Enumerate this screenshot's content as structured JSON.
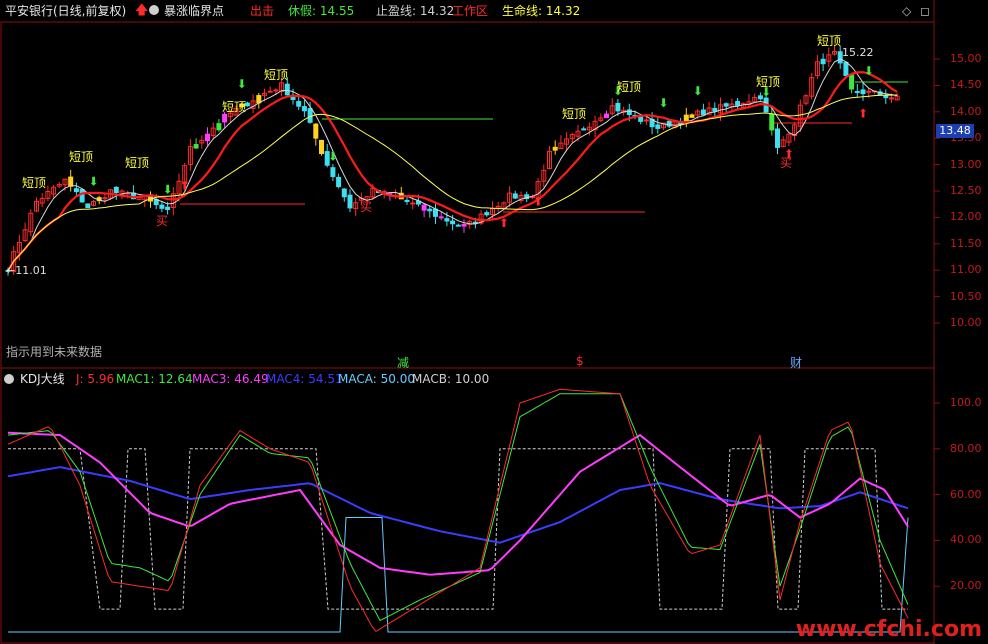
{
  "header": {
    "title": "平安银行(日线,前复权)",
    "indicator_name": "暴涨临界点",
    "items": [
      {
        "label": "出击",
        "value": "",
        "color": "#ff2a2a"
      },
      {
        "label": "休假:",
        "value": "14.55",
        "color": "#3ee83e"
      },
      {
        "label": "止盈线:",
        "value": "14.32",
        "color": "#cfcfcf"
      },
      {
        "label": "工作区",
        "value": "",
        "color": "#ff2a2a"
      },
      {
        "label": "生命线:",
        "value": "14.32",
        "color": "#ffff3c"
      }
    ]
  },
  "main_panel": {
    "price_axis": [
      "15.00",
      "14.50",
      "14.00",
      "13.50",
      "13.00",
      "12.50",
      "12.00",
      "11.50",
      "11.00",
      "10.50",
      "10.00"
    ],
    "current_price": "13.48",
    "high_label": "15.22",
    "low_label": "11.01",
    "signal_short_top": "短顶",
    "signal_buy": "买",
    "note": "指示用到未来数据",
    "bottom_markers": [
      {
        "text": "减",
        "color": "#3ee83e"
      },
      {
        "text": "$",
        "color": "#ff2a2a"
      },
      {
        "text": "财",
        "color": "#66a8ff"
      }
    ]
  },
  "kdj_panel": {
    "title": "KDJ大线",
    "legend": [
      {
        "label": "J:",
        "value": "5.96",
        "color": "#ff2a2a"
      },
      {
        "label": "MAC1:",
        "value": "12.64",
        "color": "#3ee83e"
      },
      {
        "label": "MAC3:",
        "value": "46.49",
        "color": "#ff3cff"
      },
      {
        "label": "MAC4:",
        "value": "54.51",
        "color": "#3c3cff"
      },
      {
        "label": "MACA:",
        "value": "50.00",
        "color": "#66ccff"
      },
      {
        "label": "MACB:",
        "value": "10.00",
        "color": "#cfcfcf"
      }
    ],
    "axis": [
      "100.0",
      "80.00",
      "60.00",
      "40.00",
      "20.00"
    ]
  },
  "watermark": "www.cfchi.com",
  "colors": {
    "up": "#ff2a2a",
    "down": "#3ce0f0",
    "ma_white": "#d8d8d8",
    "ma_red": "#ff1a1a",
    "ma_yellow": "#ffff5a",
    "grid": "#7a1010"
  }
}
